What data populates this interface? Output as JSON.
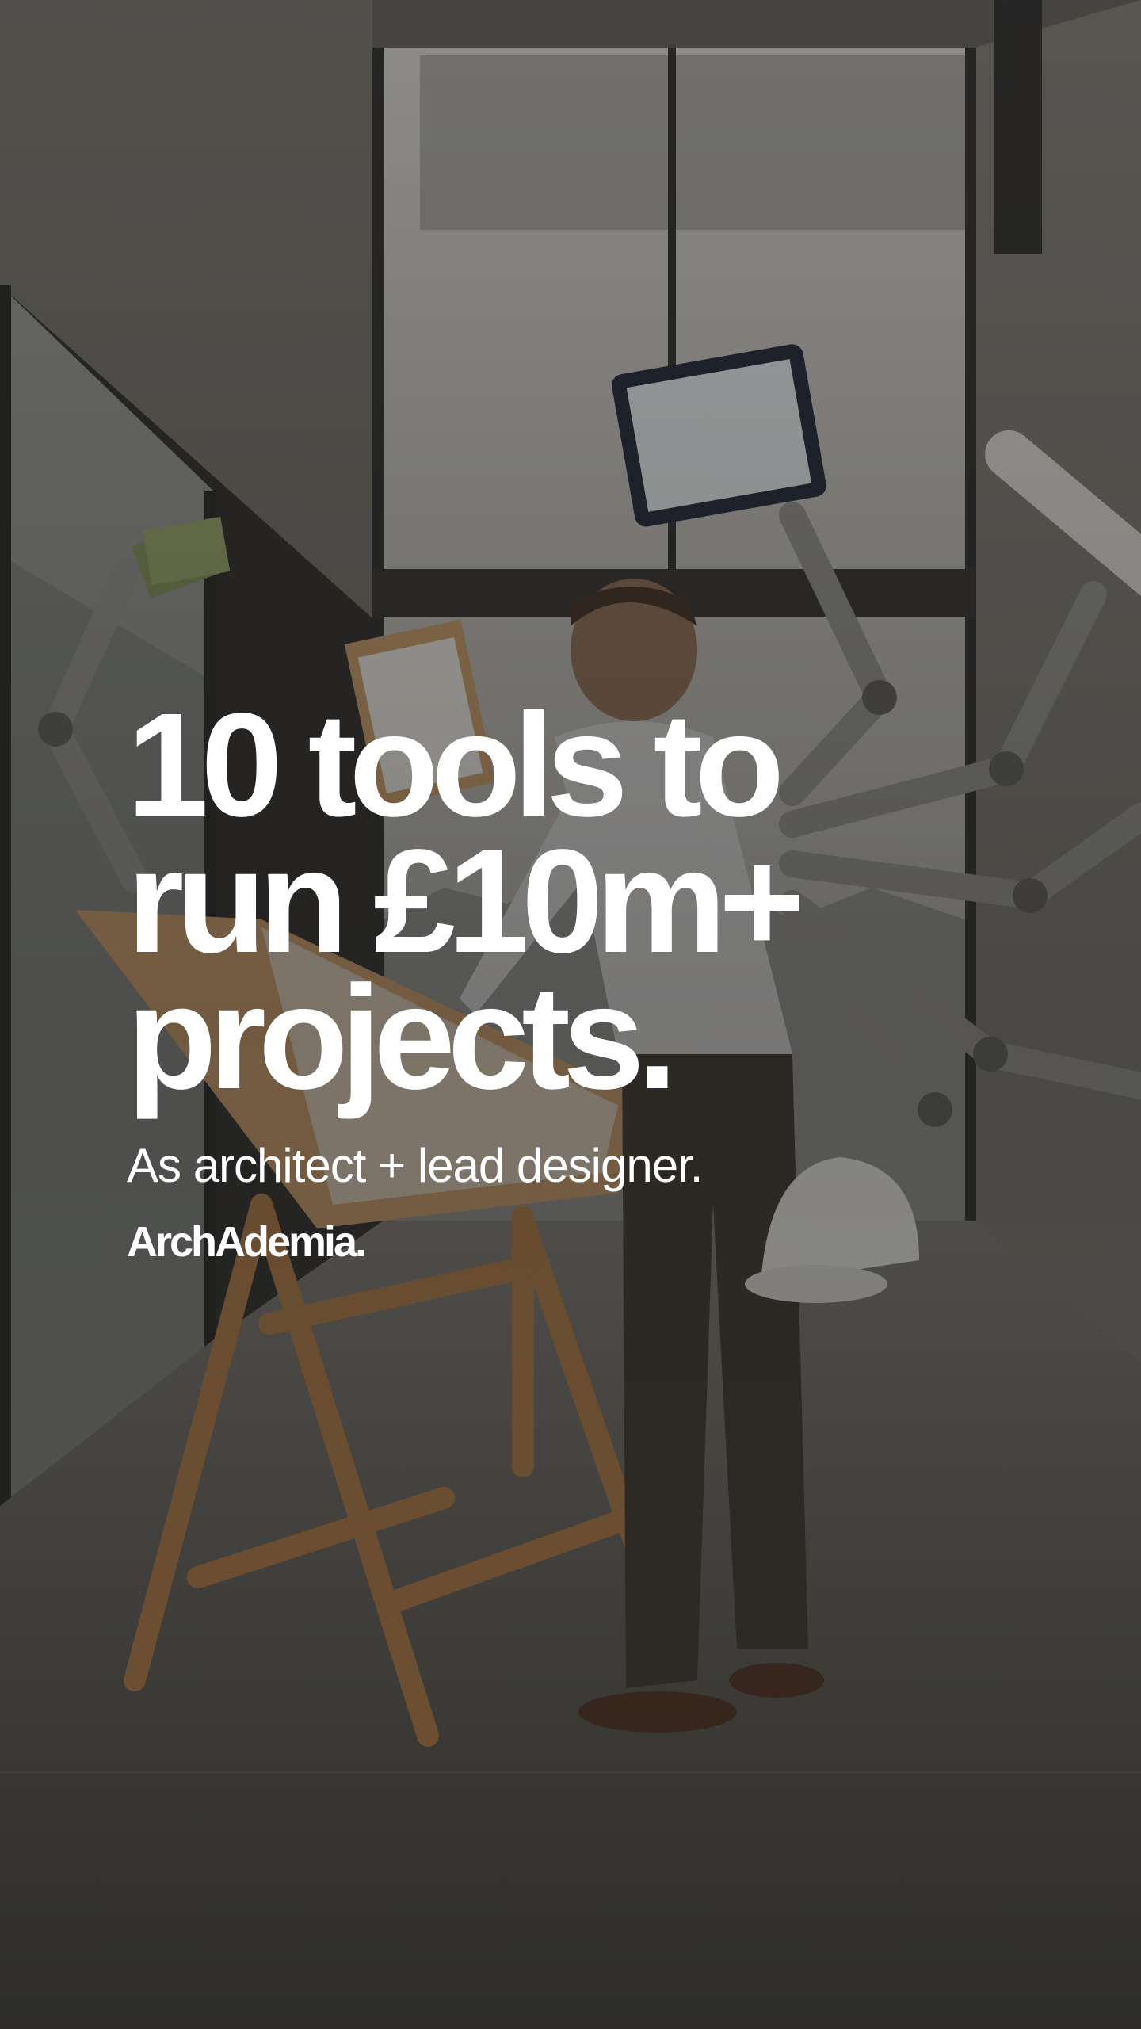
{
  "headline": {
    "line1": "10 tools to",
    "line2": "run £10m+",
    "line3": "projects."
  },
  "subheadline": "As architect + lead designer.",
  "brand": {
    "wordmark": "ArchAdemia."
  },
  "colors": {
    "text": "#ffffff",
    "overlay": "#1e1d1b",
    "wood": "#b07a45",
    "concrete": "#6f6c66"
  },
  "photo": {
    "subject": "architect-at-drafting-table",
    "props": [
      "tablet-icon",
      "clipboard-icon",
      "banknotes-icon",
      "blueprint-roll-icon",
      "hard-hat-icon",
      "robot-arm-icon"
    ]
  }
}
